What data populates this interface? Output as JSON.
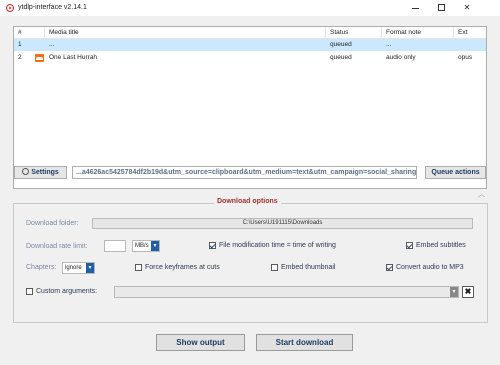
{
  "window": {
    "title": "ytdlp-interface v2.14.1",
    "minimize": "—",
    "maximize": "☐",
    "close": "✕"
  },
  "table": {
    "columns": [
      "#",
      "Media title",
      "Status",
      "Format note",
      "Ext"
    ],
    "rows": [
      {
        "num": "1",
        "title": "...",
        "status": "queued",
        "format_note": "...",
        "ext": "",
        "selected": true
      },
      {
        "num": "2",
        "title": "One Last Hurrah",
        "status": "queued",
        "format_note": "audio only",
        "ext": "opus",
        "icon": "soundcloud-icon"
      }
    ]
  },
  "toolbar": {
    "settings_label": "Settings",
    "url_value": "...a4626ac5425784df2b19d&utm_source=clipboard&utm_medium=text&utm_campaign=social_sharing",
    "queue_actions_label": "Queue actions"
  },
  "download_options": {
    "group_title": "Download options",
    "folder_label": "Download folder:",
    "folder_value": "C:\\Users\\U191115\\Downloads",
    "rate_label": "Download rate limit:",
    "rate_value": "",
    "rate_unit": "MB/s",
    "file_mod_time_label": "File modification time = time of writing",
    "file_mod_time_checked": true,
    "embed_subtitles_label": "Embed subtitles",
    "embed_subtitles_checked": true,
    "chapters_label": "Chapters:",
    "chapters_value": "ignore",
    "force_keyframes_label": "Force keyframes at cuts",
    "force_keyframes_checked": false,
    "embed_thumbnail_label": "Embed thumbnail",
    "embed_thumbnail_checked": false,
    "convert_mp3_label": "Convert audio to MP3",
    "convert_mp3_checked": true,
    "custom_args_label": "Custom arguments:",
    "custom_args_checked": false,
    "custom_args_value": ""
  },
  "bottom": {
    "show_output_label": "Show output",
    "start_download_label": "Start download"
  }
}
